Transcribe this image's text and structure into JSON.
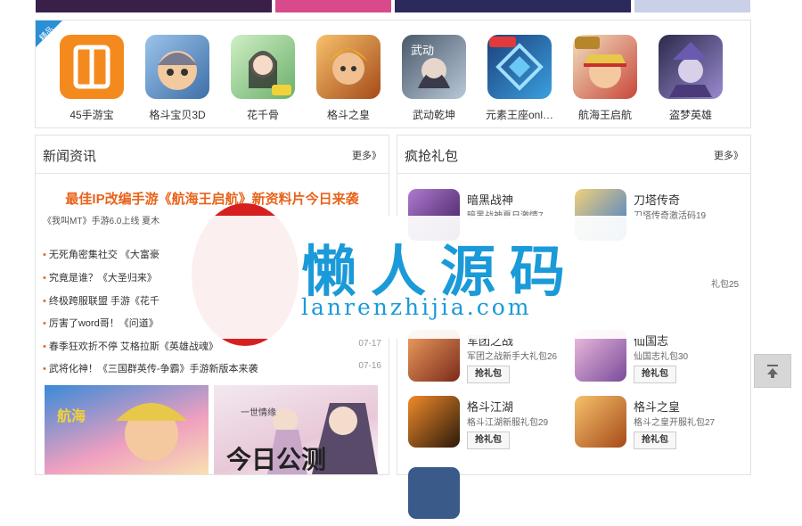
{
  "top_strip_colors": [
    "#3a1f48",
    "#d94a8c",
    "#2c2a5a",
    "#4a3a6a"
  ],
  "games_panel": {
    "badge": "精品",
    "items": [
      {
        "name": "45手游宝",
        "color": "#f48a1e",
        "icon": "45shouyoubao-icon"
      },
      {
        "name": "格斗宝贝3D",
        "color": "#6a9ad0",
        "icon": "gedou-baobei-icon"
      },
      {
        "name": "花千骨",
        "color": "#7fc97a",
        "icon": "huaqiangu-icon"
      },
      {
        "name": "格斗之皇",
        "color": "#d9882a",
        "icon": "gedou-zhihuang-icon"
      },
      {
        "name": "武动乾坤",
        "color": "#5a6a7a",
        "icon": "wudong-qiankun-icon"
      },
      {
        "name": "元素王座onl…",
        "color": "#2e6fb5",
        "icon": "yuansu-wangzuo-icon"
      },
      {
        "name": "航海王启航",
        "color": "#c9473a",
        "icon": "hanghaiwang-icon"
      },
      {
        "name": "盗梦英雄",
        "color": "#6a5a9a",
        "icon": "daomeng-yingxiong-icon"
      }
    ]
  },
  "news_panel": {
    "title": "新闻资讯",
    "more": "更多》",
    "headline": "最佳IP改编手游《航海王启航》新资料片今日来袭",
    "subline": "《我叫MT》手游6.0上线 夏木",
    "items": [
      {
        "text": "无死角密集社交 《大富豪",
        "date": ""
      },
      {
        "text": "究竟是谁？《大圣归来》",
        "date": ""
      },
      {
        "text": "终极跨服联盟 手游《花千",
        "date": ""
      },
      {
        "text": "厉害了word哥！《问道》",
        "date": ""
      },
      {
        "text": "春季狂欢折不停 艾格拉斯《英雄战魂》",
        "date": "07-17"
      },
      {
        "text": "武将化神！《三国群英传-争霸》手游新版本来袭",
        "date": "07-16"
      }
    ],
    "banner_right_text": "今日公测",
    "banner_right_top": "一世情缘"
  },
  "gifts_panel": {
    "title": "疯抢礼包",
    "more": "更多》",
    "button_label": "抢礼包",
    "items": [
      {
        "name": "暗黑战神",
        "desc": "暗黑战神夏日激情7",
        "color": "#7a3a8a"
      },
      {
        "name": "刀塔传奇",
        "desc": "刀塔传奇激活码19",
        "color": "#d9a23a"
      },
      {
        "name": "",
        "desc": "礼包25",
        "color": "#aa6a3a"
      },
      {
        "name": "军团之战",
        "desc": "军团之战新手大礼包26",
        "color": "#b04030"
      },
      {
        "name": "仙国志",
        "desc": "仙国志礼包30",
        "color": "#c07ac0"
      },
      {
        "name": "格斗江湖",
        "desc": "格斗江湖新服礼包29",
        "color": "#c85a1a"
      },
      {
        "name": "格斗之皇",
        "desc": "格斗之皇开服礼包27",
        "color": "#d9882a"
      }
    ]
  },
  "watermark": {
    "title": "懒人源码",
    "subtitle": "lanrenzhijia.com"
  },
  "back_to_top_icon": "arrow-up-to-top-icon"
}
